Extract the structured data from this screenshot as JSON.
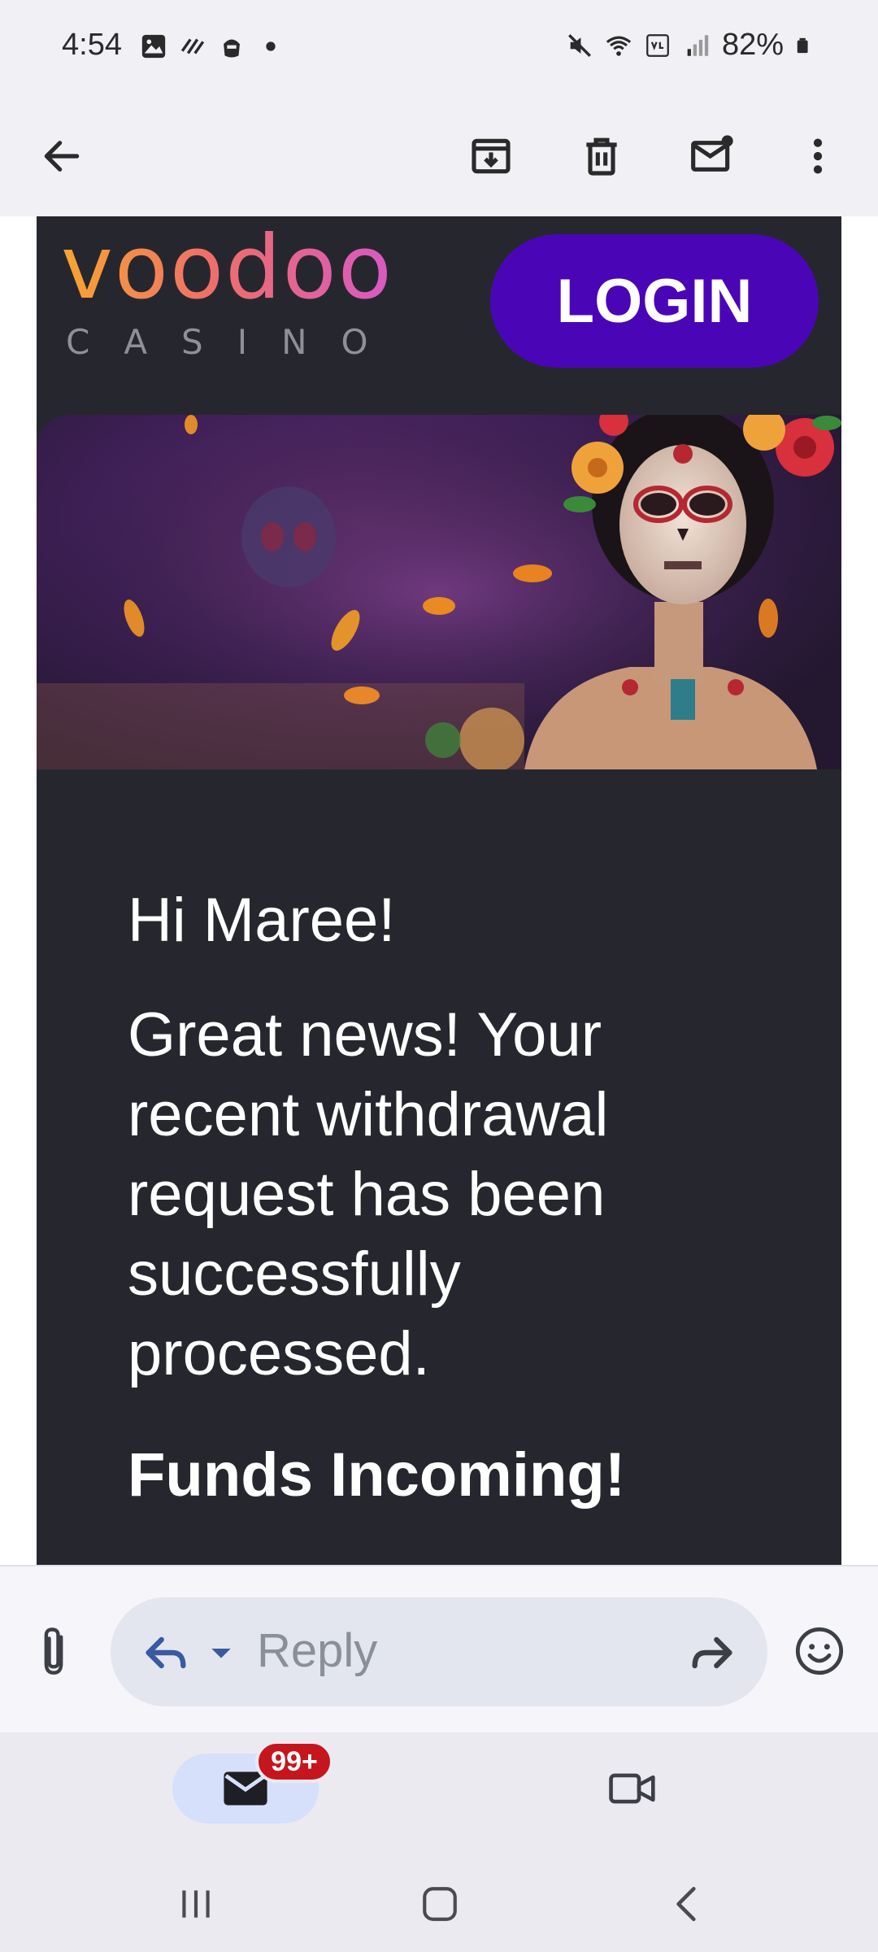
{
  "status_bar": {
    "time": "4:54",
    "battery": "82%"
  },
  "email": {
    "brand_top": "voodoo",
    "brand_bottom": "CASINO",
    "login_label": "LOGIN",
    "greeting": "Hi Maree!",
    "message": "Great news! Your recent withdrawal request has been successfully processed.",
    "headline": "Funds Incoming!"
  },
  "reply_bar": {
    "placeholder": "Reply"
  },
  "bottom_nav": {
    "mail_badge": "99+"
  },
  "colors": {
    "card_bg": "#26272e",
    "login_bg": "#4a06b6",
    "badge": "#c5161d",
    "mail_pill": "#d6e0fb"
  }
}
